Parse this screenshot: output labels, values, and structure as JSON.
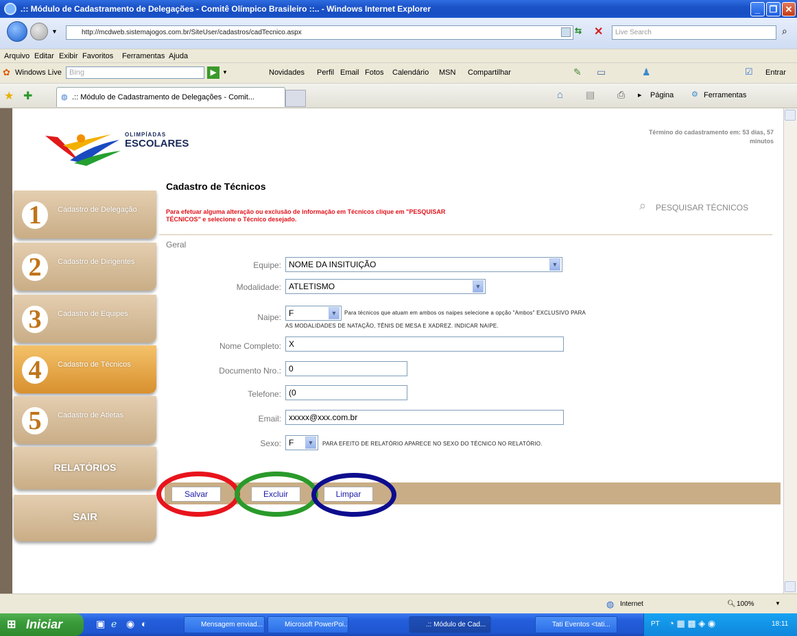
{
  "window": {
    "title": ".:: Módulo de Cadastramento de Delegações - Comitê Olímpico Brasileiro ::.. - Windows Internet Explorer"
  },
  "address": {
    "url": "http://mcdweb.sistemajogos.com.br/SiteUser/cadastros/cadTecnico.aspx",
    "search_placeholder": "Live Search"
  },
  "menu": [
    "Arquivo",
    "Editar",
    "Exibir",
    "Favoritos",
    "Ferramentas",
    "Ajuda"
  ],
  "windows_live": {
    "brand": "Windows Live",
    "search_placeholder": "Bing",
    "links": [
      "Novidades",
      "Perfil",
      "Email",
      "Fotos",
      "Calendário",
      "MSN",
      "Compartilhar"
    ],
    "signin": "Entrar"
  },
  "favbar": {
    "tab_title": ".:: Módulo de Cadastramento de Delegações - Comit...",
    "page_menu": "Página",
    "tools_menu": "Ferramentas"
  },
  "header": {
    "logo_top": "OLIMPÍADAS",
    "logo_bottom": "ESCOLARES",
    "deadline_line1": "Término do cadastramento em: 53 dias, 57",
    "deadline_line2": "minutos"
  },
  "sidebar": {
    "items": [
      {
        "number": "1",
        "label": "Cadastro de Delegação"
      },
      {
        "number": "2",
        "label": "Cadastro de Dirigentes"
      },
      {
        "number": "3",
        "label": "Cadastro de Equipes"
      },
      {
        "number": "4",
        "label": "Cadastro de Técnicos"
      },
      {
        "number": "5",
        "label": "Cadastro de Atletas"
      }
    ],
    "reports": "RELATÓRIOS",
    "exit": "SAIR"
  },
  "form": {
    "title": "Cadastro de Técnicos",
    "warning_line1": "Para efetuar alguma alteração ou exclusão de informação em Técnicos clique em \"PESQUISAR",
    "warning_line2": "TÉCNICOS\" e selecione o Técnico desejado.",
    "search_link": "PESQUISAR TÉCNICOS",
    "section": "Geral",
    "equipe": {
      "label": "Equipe:",
      "value": "NOME DA INSITUIÇÃO"
    },
    "modalidade": {
      "label": "Modalidade:",
      "value": "ATLETISMO"
    },
    "naipe": {
      "label": "Naipe:",
      "value": "F",
      "note_line1": "Para técnicos que atuam em ambos os naipes selecione a opção \"Ambos\" EXCLUSIVO PARA",
      "note_line2": "AS MODALIDADES DE NATAÇÃO, TÊNIS DE MESA E XADREZ. INDICAR NAIPE."
    },
    "nome": {
      "label": "Nome Completo:",
      "value": "X"
    },
    "documento": {
      "label": "Documento Nro.:",
      "value": "0"
    },
    "telefone": {
      "label": "Telefone:",
      "value": "(0"
    },
    "email": {
      "label": "Email:",
      "value": "xxxxx@xxx.com.br"
    },
    "sexo": {
      "label": "Sexo:",
      "value": "F",
      "note": "PARA EFEITO DE RELATÓRIO APARECE NO SEXO DO TÉCNICO NO RELATÓRIO."
    },
    "buttons": {
      "save": "Salvar",
      "delete": "Excluir",
      "clear": "Limpar"
    }
  },
  "annotation_colors": {
    "save": "#e8141c",
    "delete": "#2a9a2a",
    "clear": "#0d0d8e"
  },
  "status": {
    "zone": "Internet",
    "zoom": "100%"
  },
  "taskbar": {
    "start": "Iniciar",
    "tasks": [
      "Mensagem enviad...",
      "Microsoft PowerPoi...",
      ".:: Módulo de Cad...",
      "Tati Eventos <tati..."
    ],
    "lang": "PT",
    "clock": "18:11"
  }
}
